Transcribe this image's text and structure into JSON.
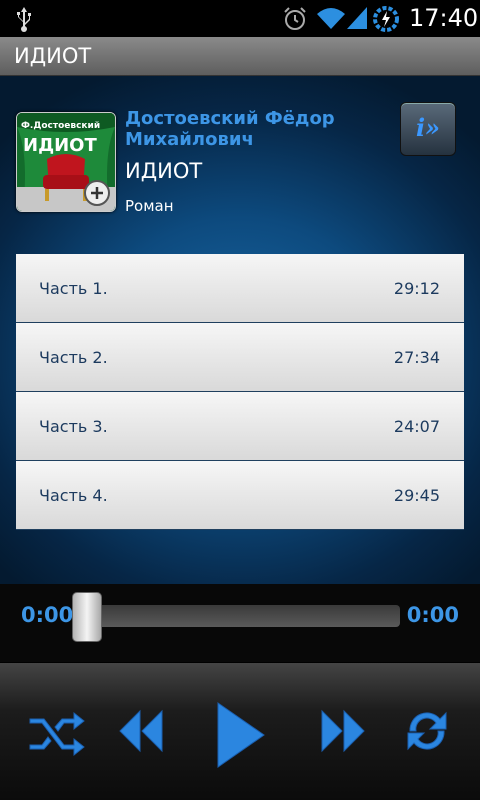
{
  "status_bar": {
    "time": "17:40",
    "icons": [
      "usb-icon",
      "alarm-icon",
      "wifi-icon",
      "signal-icon",
      "battery-charging-icon"
    ]
  },
  "titlebar": {
    "title": "ИДИОТ"
  },
  "book": {
    "author": "Достоевский Фёдор Михайлович",
    "title": "ИДИОТ",
    "genre": "Роман",
    "cover_author": "Ф.Достоевский",
    "cover_title": "ИДИОТ",
    "info_button_label": "i»"
  },
  "tracks": [
    {
      "name": "Часть 1.",
      "duration": "29:12"
    },
    {
      "name": "Часть 2.",
      "duration": "27:34"
    },
    {
      "name": "Часть 3.",
      "duration": "24:07"
    },
    {
      "name": "Часть 4.",
      "duration": "29:45"
    }
  ],
  "player": {
    "elapsed": "0:00",
    "total": "0:00",
    "progress": 0,
    "controls": [
      "shuffle-icon",
      "rewind-icon",
      "play-icon",
      "fast-forward-icon",
      "repeat-icon"
    ]
  },
  "colors": {
    "accent": "#3d96e6",
    "background": "#0d4a7e"
  }
}
